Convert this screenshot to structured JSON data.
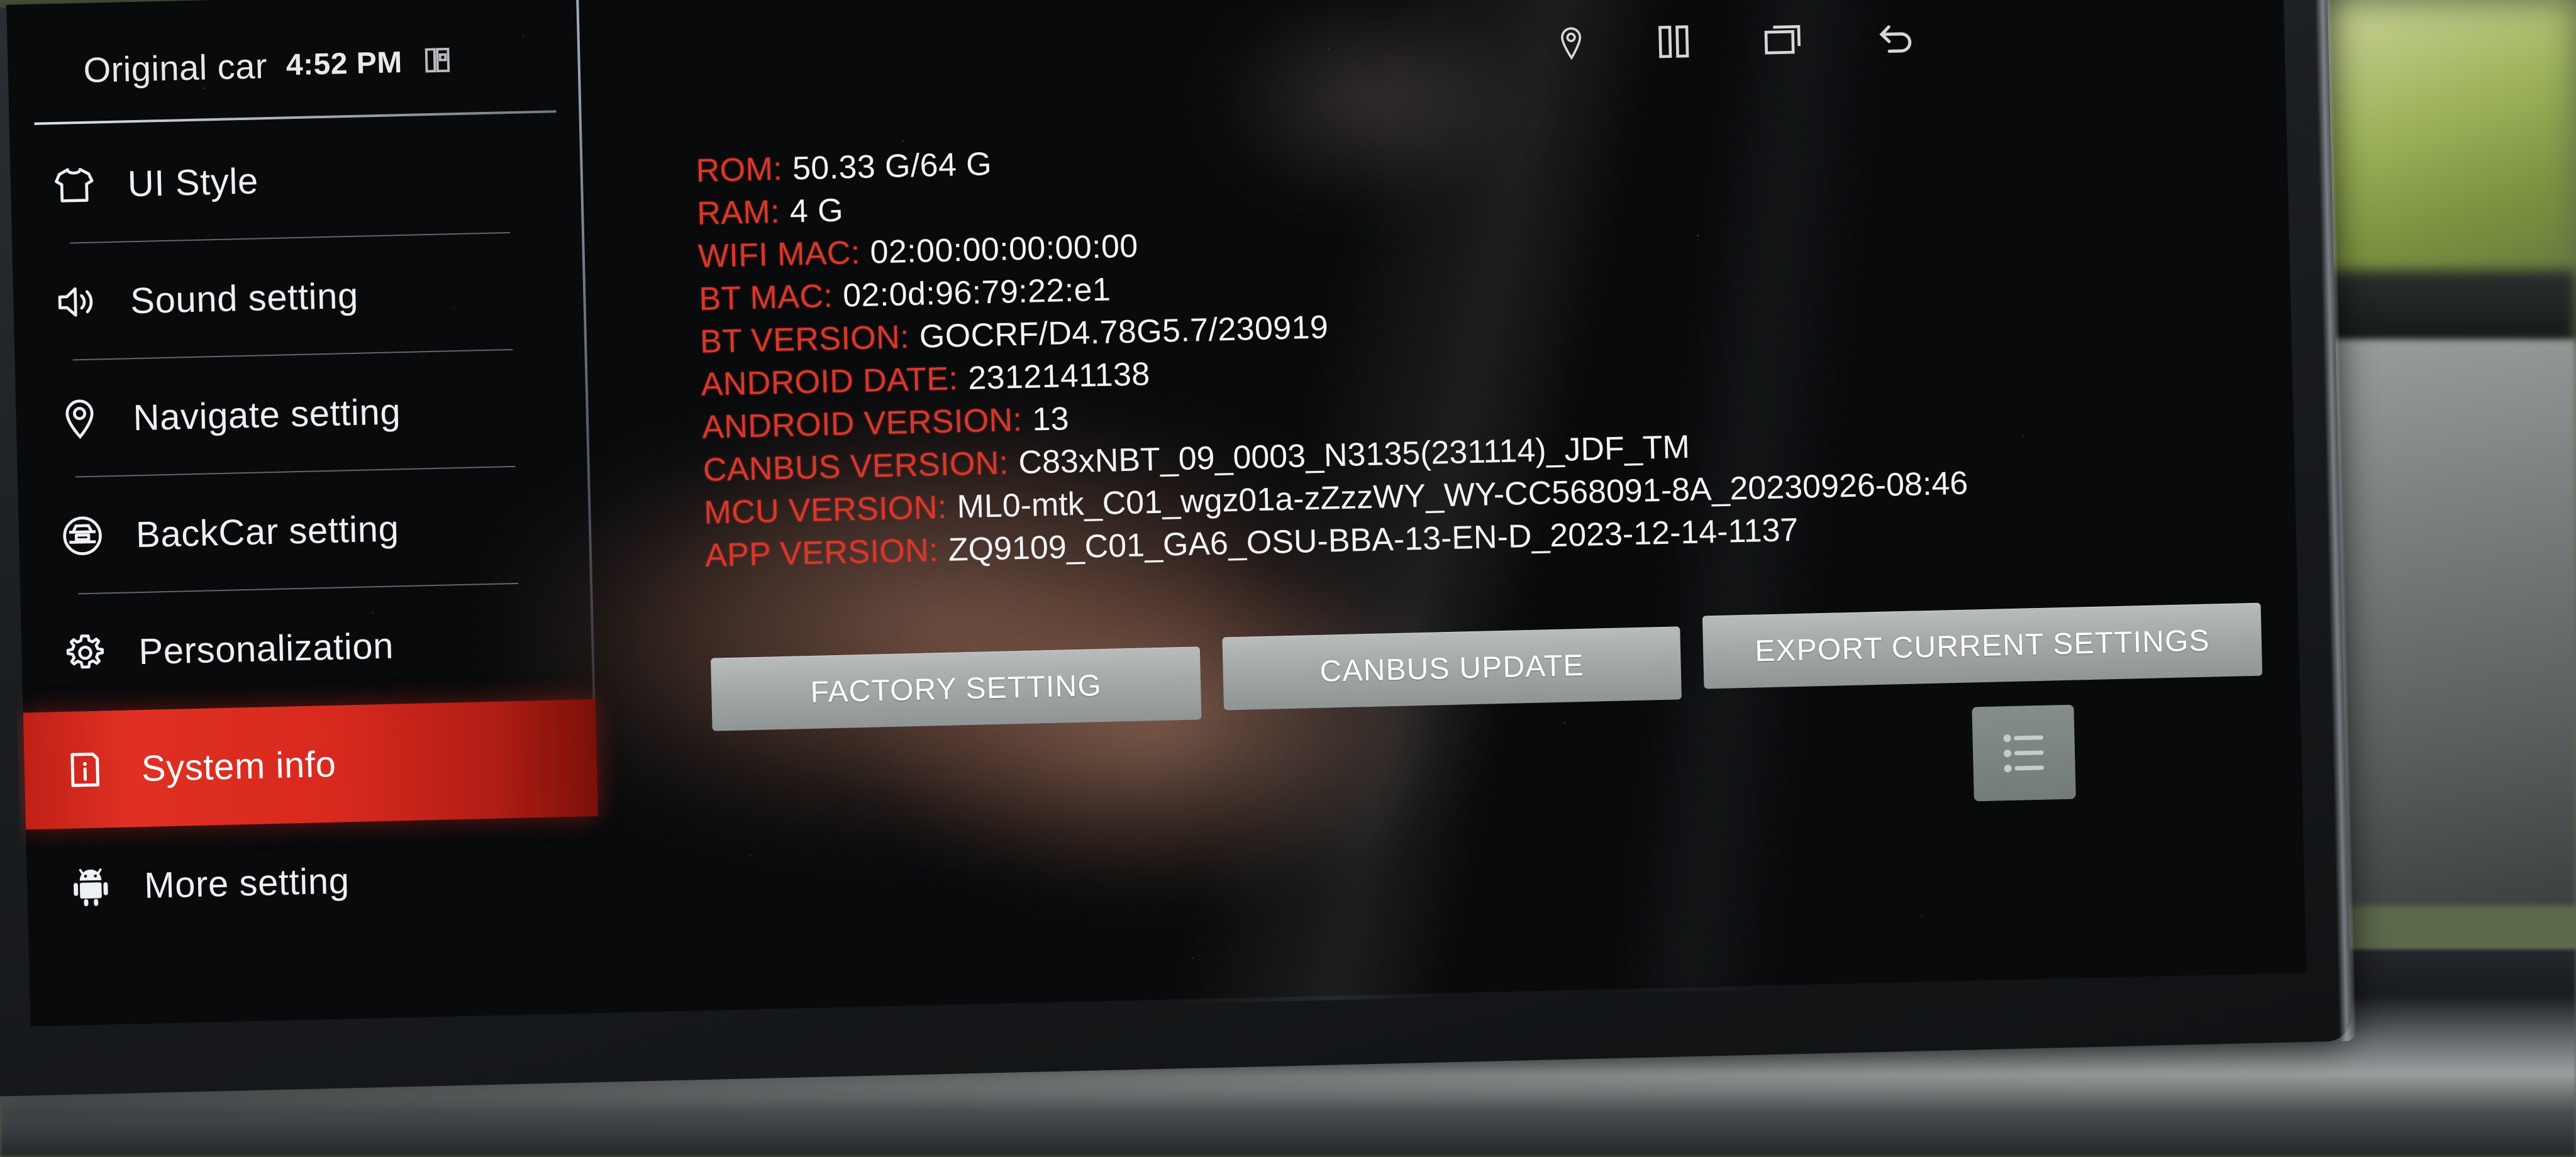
{
  "statusbar": {
    "title": "Original car",
    "clock": "4:52 PM",
    "screenshot_icon": "screenshot-icon",
    "icons": [
      {
        "name": "location-pin-icon"
      },
      {
        "name": "split-screen-icon"
      },
      {
        "name": "recent-apps-icon"
      },
      {
        "name": "back-arrow-icon"
      }
    ]
  },
  "sidebar": {
    "items": [
      {
        "label": "UI Style",
        "icon": "tshirt-icon",
        "active": false
      },
      {
        "label": "Sound setting",
        "icon": "speaker-icon",
        "active": false
      },
      {
        "label": "Navigate setting",
        "icon": "location-pin-icon",
        "active": false
      },
      {
        "label": "BackCar setting",
        "icon": "rear-camera-icon",
        "active": false
      },
      {
        "label": "Personalization",
        "icon": "gear-icon",
        "active": false
      },
      {
        "label": "System info",
        "icon": "info-box-icon",
        "active": true
      },
      {
        "label": "More setting",
        "icon": "android-robot-icon",
        "active": false
      }
    ]
  },
  "system_info": {
    "rows": [
      {
        "key": "ROM:",
        "value": "50.33 G/64 G"
      },
      {
        "key": "RAM:",
        "value": "4 G"
      },
      {
        "key": "WIFI MAC:",
        "value": "02:00:00:00:00:00"
      },
      {
        "key": "BT MAC:",
        "value": "02:0d:96:79:22:e1"
      },
      {
        "key": "BT VERSION:",
        "value": "GOCRF/D4.78G5.7/230919"
      },
      {
        "key": "ANDROID DATE:",
        "value": "2312141138"
      },
      {
        "key": "ANDROID VERSION:",
        "value": "13"
      },
      {
        "key": "CANBUS VERSION:",
        "value": "C83xNBT_09_0003_N3135(231114)_JDF_TM"
      },
      {
        "key": "MCU VERSION:",
        "value": "ML0-mtk_C01_wgz01a-zZzzWY_WY-CC568091-8A_20230926-08:46"
      },
      {
        "key": "APP VERSION:",
        "value": "ZQ9109_C01_GA6_OSU-BBA-13-EN-D_2023-12-14-1137"
      }
    ]
  },
  "buttons": {
    "factory_setting": "FACTORY SETTING",
    "canbus_update": "CANBUS UPDATE",
    "export_current_settings": "EXPORT CURRENT SETTINGS",
    "list_toggle": "list-icon"
  },
  "colors": {
    "label_red": "#d6382c",
    "value_white": "#f2f4f5",
    "highlight_red": "#d8291e",
    "screen_bg": "#080a0c",
    "button_gray": "#a4a9a8"
  }
}
